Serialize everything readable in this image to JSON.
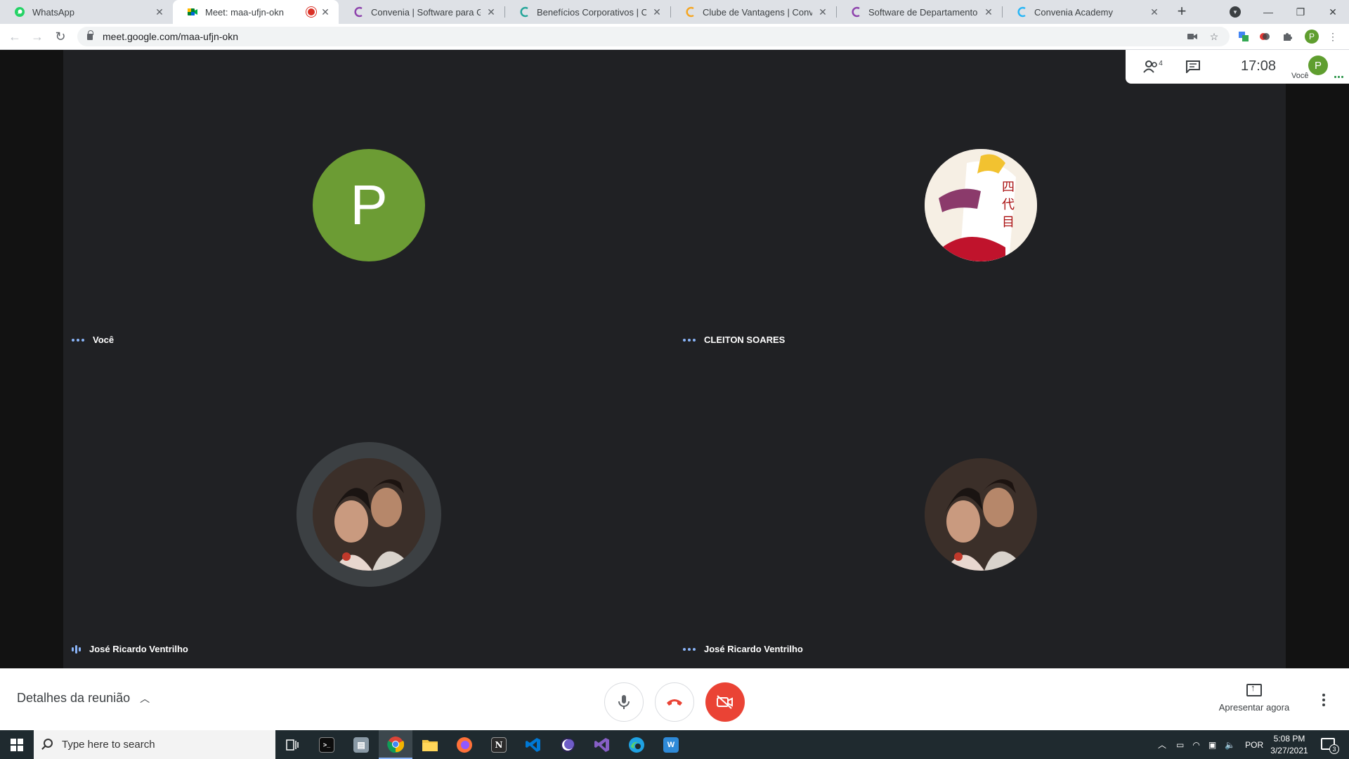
{
  "browser": {
    "tabs": [
      {
        "title": "WhatsApp",
        "icon": "whatsapp-icon",
        "color": "#25d366"
      },
      {
        "title": "Meet: maa-ufjn-okn",
        "icon": "google-meet-icon",
        "color": "#00832d",
        "active": true,
        "recording": true
      },
      {
        "title": "Convenia | Software para Gestão",
        "icon": "convenia-icon",
        "color": "#8e44ad"
      },
      {
        "title": "Benefícios Corporativos | Conver",
        "icon": "convenia-icon",
        "color": "#26a69a"
      },
      {
        "title": "Clube de Vantagens | Convenia",
        "icon": "convenia-icon",
        "color": "#f5a623"
      },
      {
        "title": "Software de Departamento Pess",
        "icon": "convenia-icon",
        "color": "#8e44ad"
      },
      {
        "title": "Convenia Academy",
        "icon": "convenia-icon",
        "color": "#29b6f6"
      }
    ],
    "url": "meet.google.com/maa-ufjn-okn",
    "profile_initial": "P"
  },
  "meet": {
    "participant_count": "4",
    "clock": "17:08",
    "self_label": "Você",
    "self_initial": "P",
    "tiles": [
      {
        "name": "Você",
        "avatar": "letter",
        "initial": "P",
        "indicator": "dots"
      },
      {
        "name": "CLEITON SOARES",
        "avatar": "anime-portrait",
        "indicator": "dots"
      },
      {
        "name": "José Ricardo Ventrilho",
        "avatar": "couple-photo",
        "indicator": "speaking",
        "speaking": true
      },
      {
        "name": "José Ricardo Ventrilho",
        "avatar": "couple-photo",
        "indicator": "dots"
      }
    ],
    "controls": {
      "details_label": "Detalhes da reunião",
      "present_label": "Apresentar agora"
    }
  },
  "taskbar": {
    "search_placeholder": "Type here to search",
    "language": "POR",
    "time": "5:08 PM",
    "date": "3/27/2021",
    "notification_count": "3",
    "apps": [
      "task-view-icon",
      "terminal-icon",
      "printer-icon",
      "chrome-icon",
      "file-explorer-icon",
      "firefox-icon",
      "notion-icon",
      "vscode-icon",
      "eclipse-icon",
      "visual-studio-icon",
      "edge-icon",
      "whiteboard-icon"
    ]
  },
  "colors": {
    "meet_background": "#202124",
    "self_avatar": "#6c9c34",
    "end_call": "#ea4335",
    "accent_dots": "#8ab4f8"
  }
}
